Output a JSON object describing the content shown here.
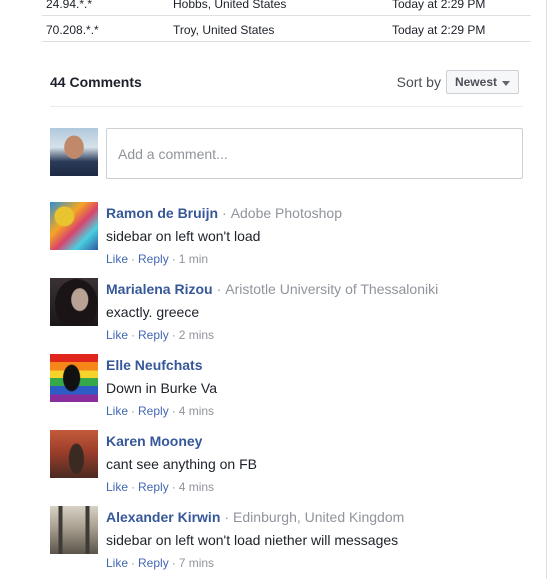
{
  "access_table": {
    "rows": [
      {
        "ip": "24.94.*.*",
        "location": "Hobbs, United States",
        "time": "Today at 2:29 PM"
      },
      {
        "ip": "70.208.*.*",
        "location": "Troy, United States",
        "time": "Today at 2:29 PM"
      }
    ]
  },
  "comments_header": {
    "count_label": "44 Comments",
    "sort_label": "Sort by",
    "sort_value": "Newest"
  },
  "composer": {
    "placeholder": "Add a comment..."
  },
  "comments": [
    {
      "author": "Ramon de Bruijn",
      "affiliation": "Adobe Photoshop",
      "text": "sidebar on left won't load",
      "like": "Like",
      "reply": "Reply",
      "time": "1 min"
    },
    {
      "author": "Marialena Rizou",
      "affiliation": "Aristotle University of Thessaloniki",
      "text": "exactly. greece",
      "like": "Like",
      "reply": "Reply",
      "time": "2 mins"
    },
    {
      "author": "Elle Neufchats",
      "affiliation": "",
      "text": "Down in Burke Va",
      "like": "Like",
      "reply": "Reply",
      "time": "4 mins"
    },
    {
      "author": "Karen Mooney",
      "affiliation": "",
      "text": "cant see anything on FB",
      "like": "Like",
      "reply": "Reply",
      "time": "4 mins"
    },
    {
      "author": "Alexander Kirwin",
      "affiliation": "Edinburgh, United Kingdom",
      "text": "sidebar on left won't load niether will messages",
      "like": "Like",
      "reply": "Reply",
      "time": "7 mins"
    }
  ],
  "colors": {
    "link": "#365899",
    "action_link": "#4267b2",
    "muted": "#90949c",
    "text": "#1d2129"
  }
}
